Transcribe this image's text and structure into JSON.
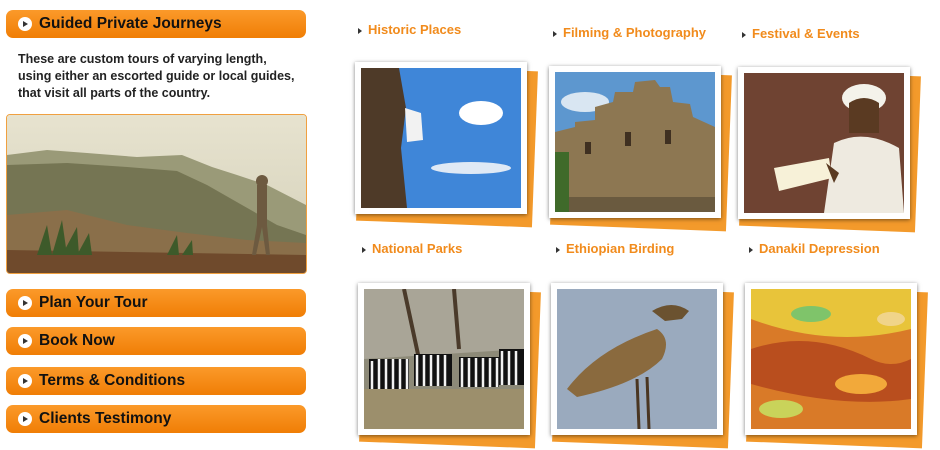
{
  "sidebar": {
    "title": "Guided Private Journeys",
    "intro": "These are custom tours of varying length, using either an escorted guide or local guides, that visit all parts of the country.",
    "buttons": [
      "Plan Your Tour",
      "Book Now",
      "Terms & Conditions",
      "Clients Testimony"
    ]
  },
  "categories": [
    {
      "label": "Historic Places"
    },
    {
      "label": "Filming & Photography"
    },
    {
      "label": "Festival & Events"
    },
    {
      "label": "National Parks"
    },
    {
      "label": "Ethiopian Birding"
    },
    {
      "label": "Danakil Depression"
    }
  ],
  "colors": {
    "accent": "#f78a12",
    "heading": "#f18b1c"
  }
}
